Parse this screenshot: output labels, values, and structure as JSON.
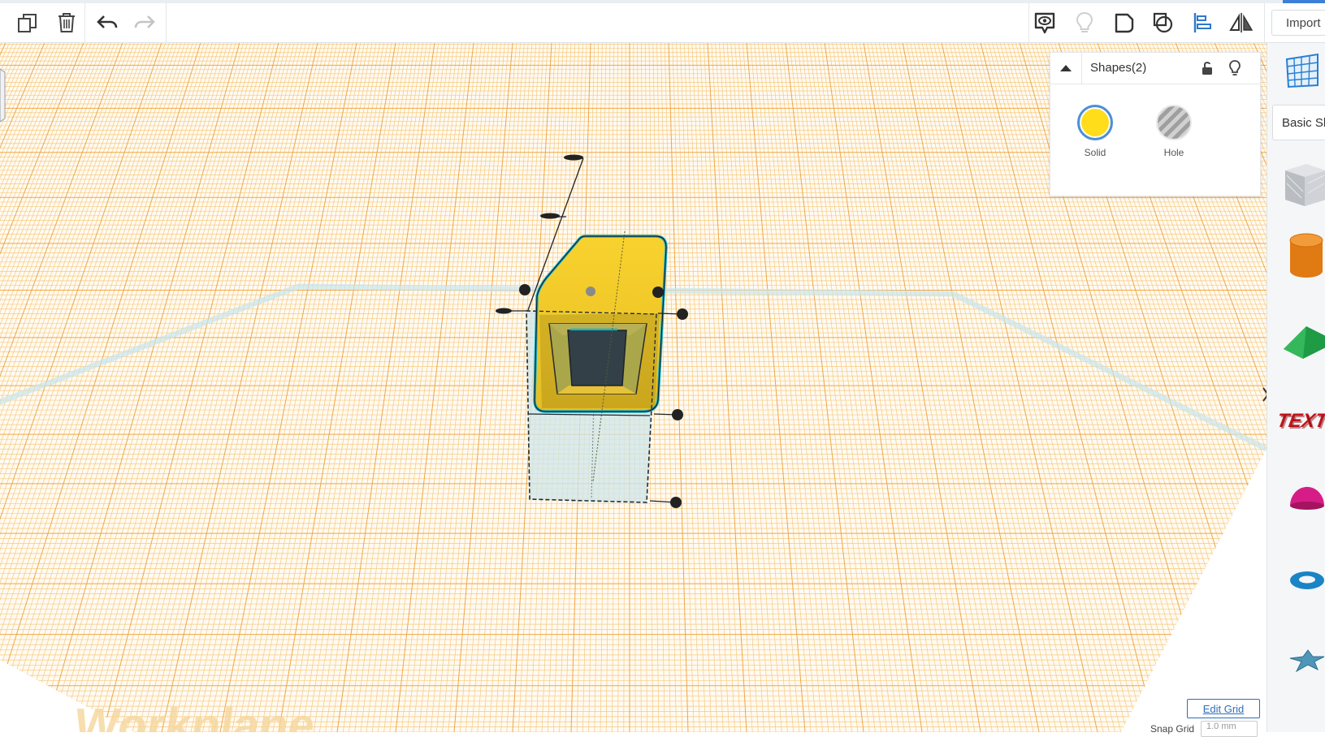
{
  "toolbar": {
    "icons": [
      "copy-icon",
      "trash-icon",
      "undo-icon",
      "redo-icon",
      "notes-icon",
      "lightbulb-icon",
      "group-icon",
      "ungroup-icon",
      "align-icon",
      "mirror-icon"
    ],
    "import_label": "Import"
  },
  "inspector": {
    "title": "Shapes(2)",
    "solid_label": "Solid",
    "hole_label": "Hole",
    "solid_color": "#ffdd1a",
    "hole_color": "#b5b5b5"
  },
  "viewport": {
    "workplane_label": "Workplane",
    "edit_grid_label": "Edit Grid",
    "snap_grid_label": "Snap Grid",
    "snap_grid_value": "1.0 mm"
  },
  "right_panel": {
    "category": "Basic Shapes",
    "shapes": [
      "box",
      "cylinder",
      "roof",
      "text",
      "half-sphere",
      "torus",
      "star"
    ]
  },
  "colors": {
    "grid_minor": "#f6ca7e",
    "grid_major": "#f1a846",
    "selection": "#19b4cf",
    "shape_yellow": "#f7d335",
    "hole_fill": "#cfe7ea"
  }
}
